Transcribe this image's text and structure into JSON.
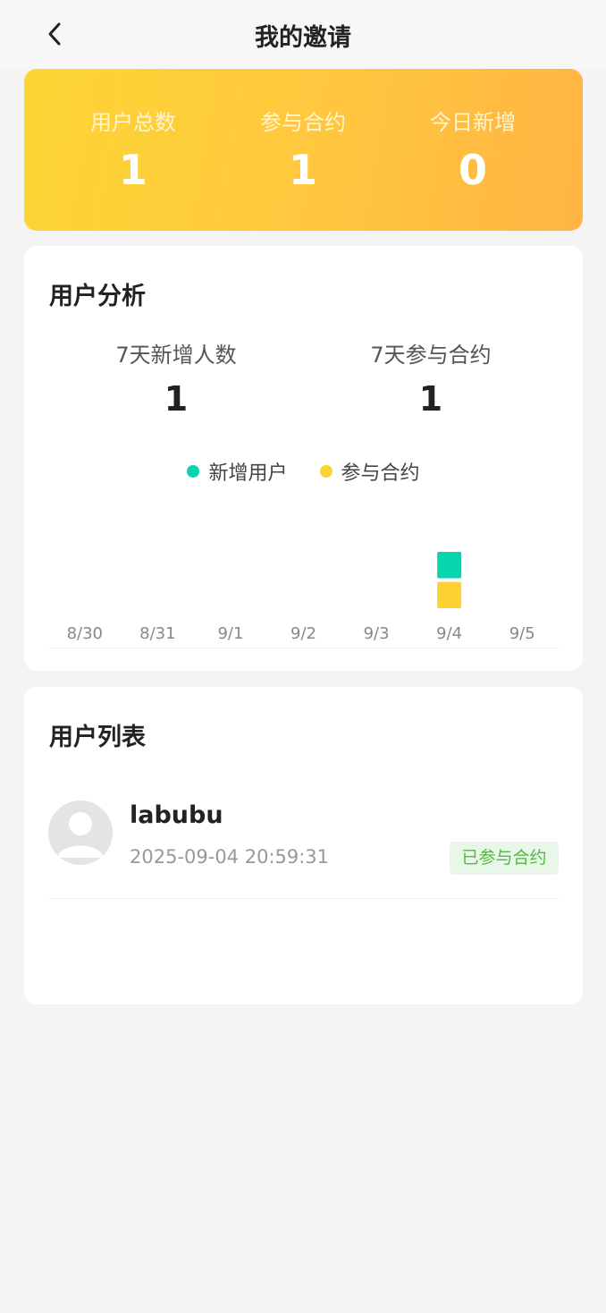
{
  "header": {
    "title": "我的邀请"
  },
  "stats": [
    {
      "label": "用户总数",
      "value": "1"
    },
    {
      "label": "参与合约",
      "value": "1"
    },
    {
      "label": "今日新增",
      "value": "0"
    }
  ],
  "analysis": {
    "title": "用户分析",
    "summary": [
      {
        "label": "7天新增人数",
        "value": "1"
      },
      {
        "label": "7天参与合约",
        "value": "1"
      }
    ],
    "legend": [
      {
        "label": "新增用户",
        "color": "#06d6ad"
      },
      {
        "label": "参与合约",
        "color": "#fdd334"
      }
    ]
  },
  "chart_data": {
    "type": "bar",
    "categories": [
      "8/30",
      "8/31",
      "9/1",
      "9/2",
      "9/3",
      "9/4",
      "9/5"
    ],
    "series": [
      {
        "name": "新增用户",
        "values": [
          0,
          0,
          0,
          0,
          0,
          1,
          0
        ],
        "color": "#06d6ad"
      },
      {
        "name": "参与合约",
        "values": [
          0,
          0,
          0,
          0,
          0,
          1,
          0
        ],
        "color": "#fdd334"
      }
    ],
    "stacked": true,
    "grid": false,
    "legend_position": "top"
  },
  "user_list": {
    "title": "用户列表",
    "users": [
      {
        "name": "labubu",
        "time": "2025-09-04 20:59:31",
        "status": "已参与合约"
      }
    ]
  }
}
